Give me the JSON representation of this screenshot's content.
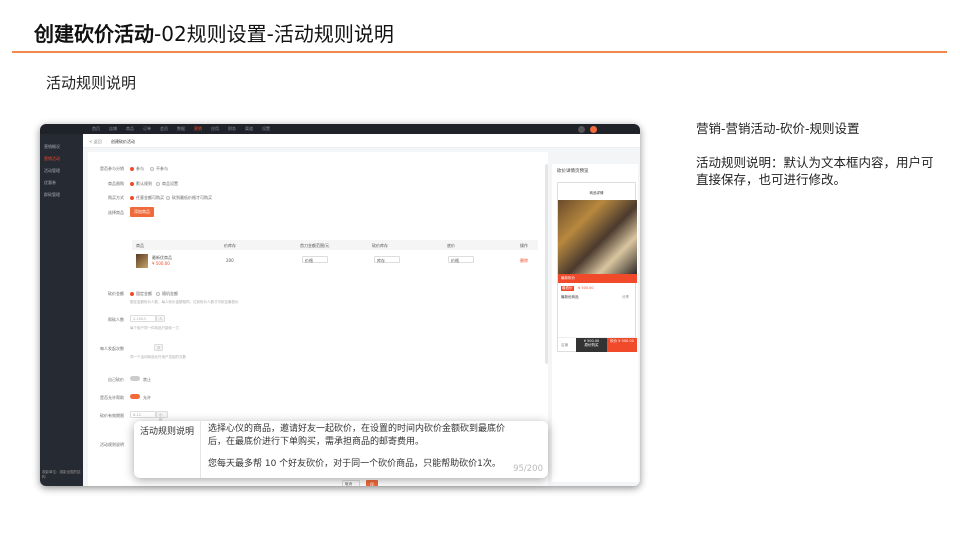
{
  "header": {
    "title_bold": "创建砍价活动",
    "title_rest": "-02规则设置-活动规则说明"
  },
  "subtitle": "活动规则说明",
  "description": {
    "heading": "营销-营销活动-砍价-规则设置",
    "body": "活动规则说明：默认为文本框内容，用户可直接保存，也可进行修改。"
  },
  "colors": {
    "accent": "#f04a2a",
    "rule": "#f08a4b"
  },
  "app": {
    "topnav": [
      "首页",
      "店铺",
      "商品",
      "订单",
      "会员",
      "数据",
      "营销",
      "应用",
      "财务",
      "渠道",
      "设置"
    ],
    "topnav_active": "营销",
    "sidebar": [
      "营销概况",
      "营销活动",
      "活动管理",
      "优惠券",
      "群砍管理"
    ],
    "sidebar_active": "营销活动",
    "sidebar_bottom": "观影单位：观影全国的结构",
    "breadcrumb_back": "< 返回",
    "breadcrumb_title": "创建砍价活动",
    "form": {
      "r1_label": "是否参与分销",
      "r1_opt1": "参与",
      "r1_opt2": "不参与",
      "r2_label": "商品限购",
      "r2_opt1": "默认规则",
      "r2_opt2": "商品设置",
      "r3_label": "购买方式",
      "r3_opt1": "任意金额可购买",
      "r3_opt2": "砍到最低价格才可购买",
      "r4_label": "选择商品",
      "add_goods_button": "添加商品",
      "table_headers": [
        "商品",
        "价库存",
        "首刀金额范围/元",
        "砍价库存",
        "底价",
        "操作"
      ],
      "goods_name": "最新优商品",
      "goods_price": "¥ 500.00",
      "goods_stock": "200",
      "goods_price_ph": "价格",
      "goods_stock_ph": "库存",
      "goods_floor_ph": "价格",
      "goods_delete": "删除",
      "r5_label": "砍价金额",
      "r5_opt1": "固定金额",
      "r5_opt2": "随机金额",
      "r5_hint": "固定金额砍价人数，每人砍价金额相同，达到砍价人数才可砍至最低价",
      "r6_label": "帮砍人数",
      "r6_ph": "2-100人",
      "r6_unit": "人",
      "r6_hint": "每个用户同一件商品只能砍一刀",
      "r7_label": "每人发起次数",
      "r7_unit": "次",
      "r7_hint": "同一个活动商品允许用户发起的次数",
      "r8_label": "自己砍价",
      "r8_val": "禁止",
      "r9_label": "是否允许帮助",
      "r9_val": "允许",
      "r10_label": "砍价有效期限",
      "r10_ph": "6-12",
      "r10_unit": "小时",
      "r11_label": "活动规则说明",
      "cancel_button": "取消",
      "save_button": "保存"
    },
    "preview": {
      "title": "砍价详情页预览",
      "phone_header": "商品详情",
      "banner": "最新砍价",
      "tag": "最低价",
      "price": "¥ 500.00",
      "goods": "最新优商品",
      "share": "分享",
      "buy_now": "¥ 500.00",
      "buy_now_label": "原价购买",
      "bargain": "¥ 500.00",
      "bargain_label": "砍价",
      "home": "店铺"
    }
  },
  "callout": {
    "label": "活动规则说明",
    "text1": "选择心仪的商品，邀请好友一起砍价，在设置的时间内砍价金额砍到最底价后，在最底价进行下单购买，需承担商品的邮寄费用。",
    "text2": "您每天最多帮  10 个好友砍价，对于同一个砍价商品，只能帮助砍价1次。",
    "count": "95/200"
  }
}
